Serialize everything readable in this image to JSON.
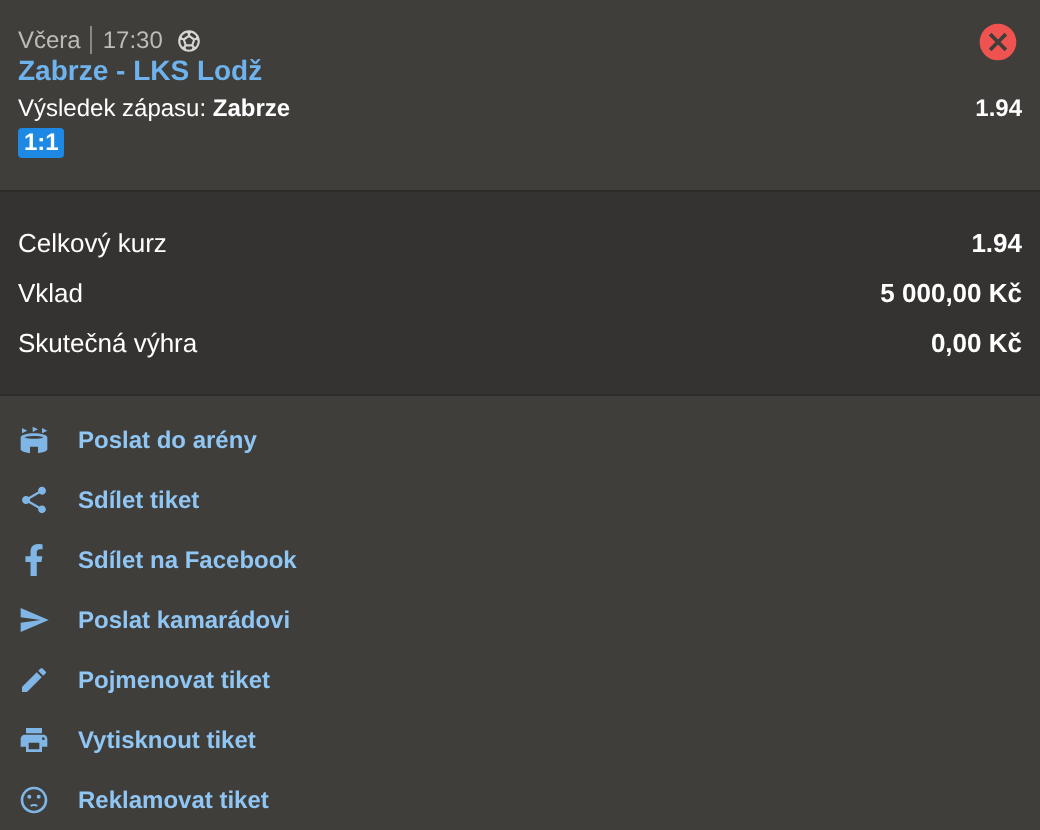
{
  "bet": {
    "day": "Včera",
    "time": "17:30",
    "match": "Zabrze - LKS Lodž",
    "market_label": "Výsledek zápasu:",
    "pick": "Zabrze",
    "odds": "1.94",
    "score": "1:1"
  },
  "summary": [
    {
      "label": "Celkový kurz",
      "value": "1.94"
    },
    {
      "label": "Vklad",
      "value": "5 000,00 Kč"
    },
    {
      "label": "Skutečná výhra",
      "value": "0,00 Kč"
    }
  ],
  "actions": [
    {
      "kind": "arena",
      "label": "Poslat do arény"
    },
    {
      "kind": "share",
      "label": "Sdílet tiket"
    },
    {
      "kind": "facebook",
      "label": "Sdílet na Facebook"
    },
    {
      "kind": "send",
      "label": "Poslat kamarádovi"
    },
    {
      "kind": "rename",
      "label": "Pojmenovat tiket"
    },
    {
      "kind": "print",
      "label": "Vytisknout tiket"
    },
    {
      "kind": "complain",
      "label": "Reklamovat tiket"
    }
  ]
}
